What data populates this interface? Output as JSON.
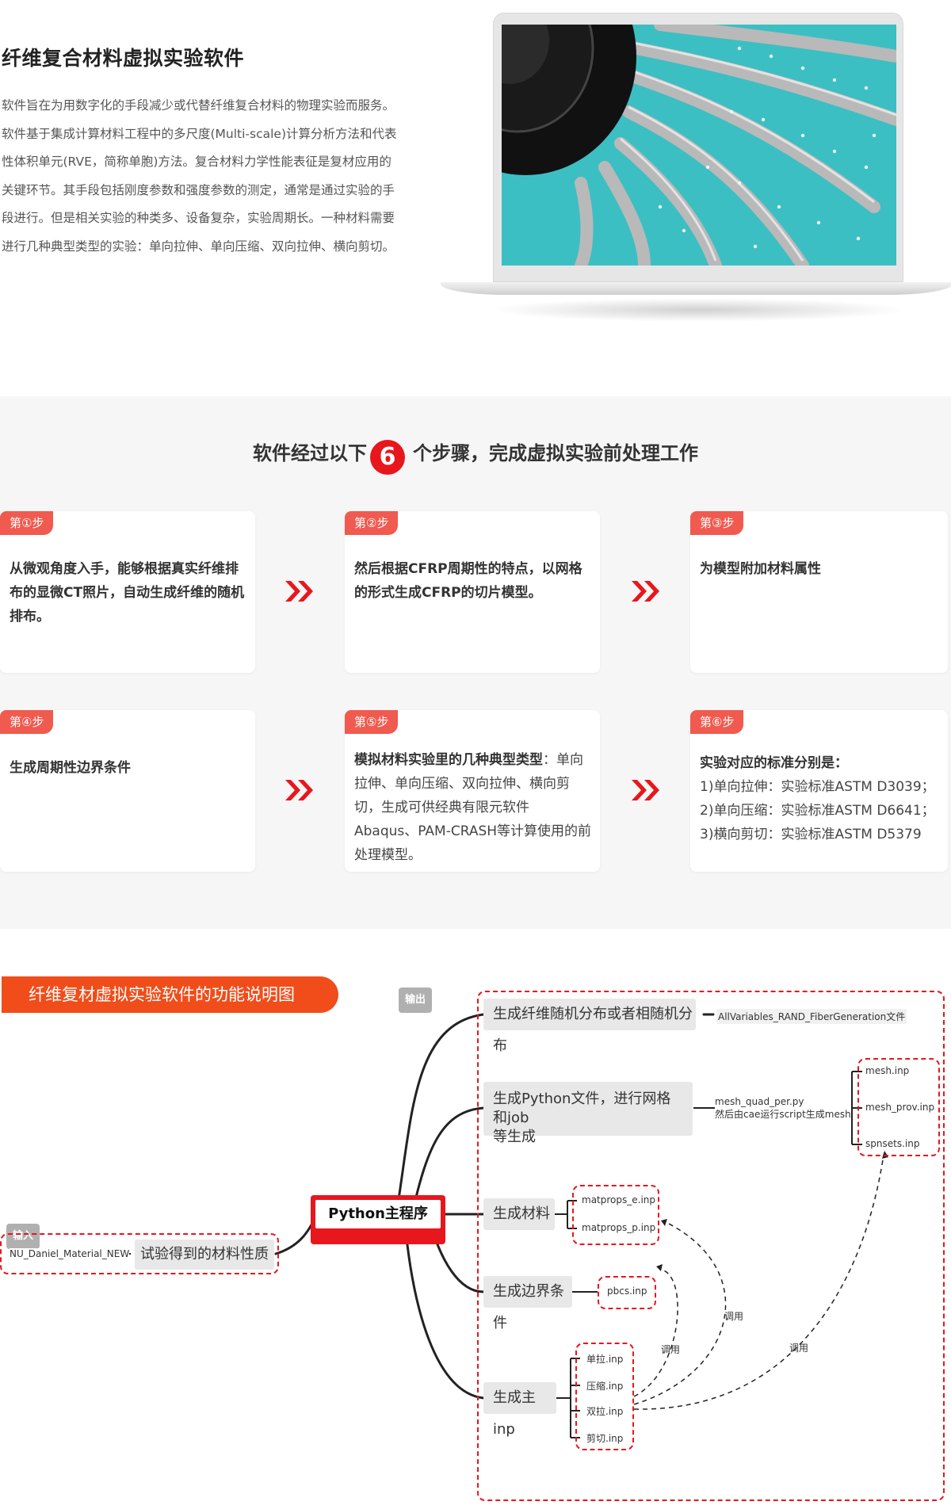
{
  "intro": {
    "title": "纤维复合材料虚拟实验软件",
    "lines": [
      "软件旨在为用数字化的手段减少或代替纤维复合材料的物理实验而服务。",
      "软件基于集成计算材料工程中的多尺度(Multi-scale)计算分析方法和代表",
      "性体积单元(RVE，简称单胞)方法。复合材料力学性能表征是复材应用的",
      "关键环节。其手段包括刚度参数和强度参数的测定，通常是通过实验的手",
      "段进行。但是相关实验的种类多、设备复杂，实验周期长。一种材料需要",
      "进行几种典型类型的实验：单向拉伸、单向压缩、双向拉伸、横向剪切。"
    ]
  },
  "steps": {
    "heading_before": "软件经过以下",
    "heading_number": "6",
    "heading_after": "个步骤，完成虚拟实验前处理工作",
    "cards": [
      {
        "tag": "第①步",
        "text": "从微观角度入手，能够根据真实纤维排布的显微CT照片，自动生成纤维的随机排布。"
      },
      {
        "tag": "第②步",
        "text": "然后根据CFRP周期性的特点，以网格的形式生成CFRP的切片模型。"
      },
      {
        "tag": "第③步",
        "text": "为模型附加材料属性"
      },
      {
        "tag": "第④步",
        "text": "生成周期性边界条件"
      },
      {
        "tag": "第⑤步",
        "bold": "模拟材料实验里的几种典型类型",
        "rest": "：单向拉伸、单向压缩、双向拉伸、横向剪切，生成可供经典有限元软件Abaqus、PAM-CRASH等计算使用的前处理模型。"
      },
      {
        "tag": "第⑥步",
        "bold": "实验对应的标准分别是：",
        "lines": [
          "1)单向拉伸：实验标准ASTM D3039；",
          "2)单向压缩：实验标准ASTM D6641；",
          "3)横向剪切：实验标准ASTM D5379"
        ]
      }
    ]
  },
  "mindmap": {
    "title": "纤维复材虚拟实验软件的功能说明图",
    "badge_output": "输出",
    "badge_input": "输入",
    "main": "Python主程序",
    "input_file": "NU_Daniel_Material_NEW",
    "input_node": "试验得到的材料性质",
    "branch1": "生成纤维随机分布或者相随机分布",
    "branch1_file": "AllVariables_RAND_FiberGeneration文件",
    "branch2_line1": "生成Python文件，进行网格和job",
    "branch2_line2": "等生成",
    "branch2_file1": "mesh_quad_per.py",
    "branch2_file2": "然后由cae运行script生成mesh",
    "mesh_files": [
      "mesh.inp",
      "mesh_prov.inp",
      "spnsets.inp"
    ],
    "branch3": "生成材料",
    "mat_files": [
      "matprops_e.inp",
      "matprops_p.inp"
    ],
    "branch4": "生成边界条件",
    "bc_file": "pbcs.inp",
    "branch5": "生成主inp",
    "main_files": [
      "单拉.inp",
      "压缩.inp",
      "双拉.inp",
      "剪切.inp"
    ],
    "call_labels": [
      "调用",
      "调用",
      "调用"
    ]
  },
  "colors": {
    "accent_red": "#e8161d",
    "tag_red": "#f05a4f",
    "title_orange": "#f04d1b",
    "bg_gray": "#f6f6f6",
    "node_gray": "#e8e8e8"
  }
}
